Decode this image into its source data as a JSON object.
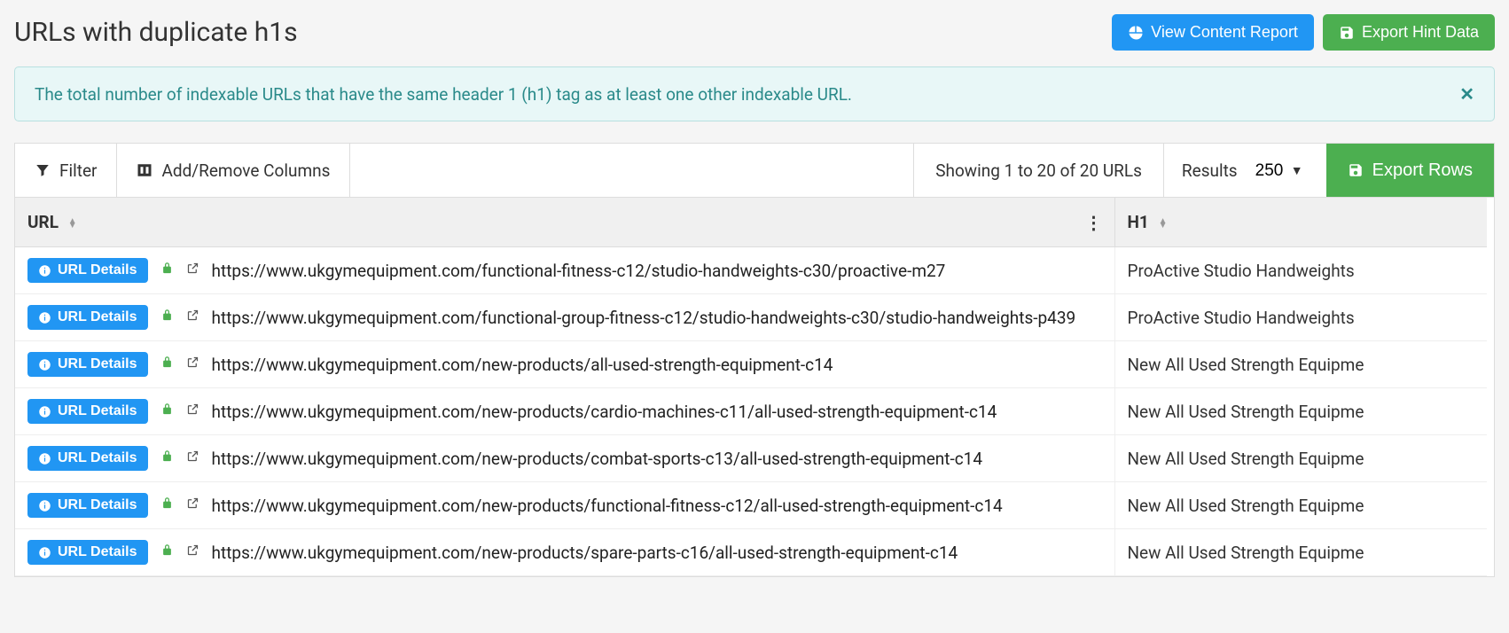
{
  "page": {
    "title": "URLs with duplicate h1s",
    "view_content_report": "View Content Report",
    "export_hint_data": "Export Hint Data"
  },
  "banner": {
    "text": "The total number of indexable URLs that have the same header 1 (h1) tag as at least one other indexable URL."
  },
  "toolbar": {
    "filter": "Filter",
    "add_remove_columns": "Add/Remove Columns",
    "showing": "Showing 1 to 20 of 20 URLs",
    "results_label": "Results",
    "results_value": "250",
    "export_rows": "Export Rows"
  },
  "table": {
    "columns": {
      "url": "URL",
      "h1": "H1"
    },
    "url_details_label": "URL Details",
    "rows": [
      {
        "url": "https://www.ukgymequipment.com/functional-fitness-c12/studio-handweights-c30/proactive-m27",
        "h1": "ProActive Studio Handweights"
      },
      {
        "url": "https://www.ukgymequipment.com/functional-group-fitness-c12/studio-handweights-c30/studio-handweights-p439",
        "h1": "ProActive Studio Handweights"
      },
      {
        "url": "https://www.ukgymequipment.com/new-products/all-used-strength-equipment-c14",
        "h1": "New All Used Strength Equipme"
      },
      {
        "url": "https://www.ukgymequipment.com/new-products/cardio-machines-c11/all-used-strength-equipment-c14",
        "h1": "New All Used Strength Equipme"
      },
      {
        "url": "https://www.ukgymequipment.com/new-products/combat-sports-c13/all-used-strength-equipment-c14",
        "h1": "New All Used Strength Equipme"
      },
      {
        "url": "https://www.ukgymequipment.com/new-products/functional-fitness-c12/all-used-strength-equipment-c14",
        "h1": "New All Used Strength Equipme"
      },
      {
        "url": "https://www.ukgymequipment.com/new-products/spare-parts-c16/all-used-strength-equipment-c14",
        "h1": "New All Used Strength Equipme"
      }
    ]
  }
}
